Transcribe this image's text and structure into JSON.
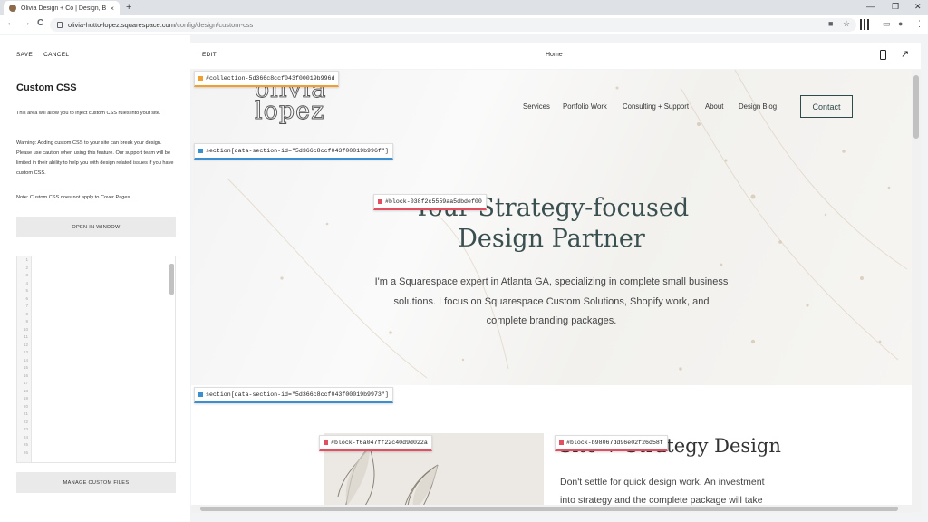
{
  "browser": {
    "tab_title": "Olivia Design + Co | Design, Bran",
    "tab_close": "×",
    "new_tab": "+",
    "window_controls": [
      "—",
      "❐",
      "✕"
    ],
    "nav_back": "←",
    "nav_forward": "→",
    "nav_reload": "C",
    "url_host": "olivia-hutto-lopez.squarespace.com",
    "url_path": "/config/design/custom-css",
    "icons": [
      "camera-icon",
      "star-icon",
      "extension-icon",
      "cast-icon",
      "profile-icon",
      "menu-icon"
    ]
  },
  "left_panel": {
    "save": "SAVE",
    "cancel": "CANCEL",
    "title": "Custom CSS",
    "intro": "This area will allow you to inject custom CSS rules into your site.",
    "warning": "Warning: Adding custom CSS to your site can break your design. Please use caution when using this feature. Our support team will be limited in their ability to help you with design related issues if you have custom CSS.",
    "note": "Note: Custom CSS does not apply to Cover Pages.",
    "open_window": "OPEN IN WINDOW",
    "manage_files": "MANAGE CUSTOM FILES",
    "line_numbers": [
      "1",
      "2",
      "3",
      "4",
      "5",
      "6",
      "7",
      "8",
      "9",
      "10",
      "11",
      "12",
      "13",
      "14",
      "15",
      "16",
      "17",
      "18",
      "19",
      "20",
      "21",
      "22",
      "23",
      "24",
      "25",
      "26"
    ]
  },
  "preview": {
    "edit": "EDIT",
    "page_name": "Home",
    "expand_glyph": "↗"
  },
  "site": {
    "logo_line1": "olivia",
    "logo_line2": "lopez",
    "nav": [
      "Services",
      "Portfolio Work",
      "Consulting + Support",
      "About",
      "Design Blog"
    ],
    "contact": "Contact",
    "headline_line1": "Your Strategy-focused",
    "headline_line2": "Design Partner",
    "subtext": "I'm a Squarespace expert in Atlanta GA, specializing in complete small business solutions. I focus on Squarespace Custom Solutions, Shopify work, and complete branding packages.",
    "section2_title": "Site + Strategy Design",
    "section2_text": "Don't settle for quick design work. An investment into strategy and the complete package will take"
  },
  "selectors": {
    "collection": "#collection-5d366c8ccf043f00019b996d",
    "section1": "section[data-section-id=\"5d366c8ccf043f00019b996f\"]",
    "block_headline": "#block-038f2c5559aa5dbdef00",
    "section2": "section[data-section-id=\"5d366c8ccf043f00019b9973\"]",
    "block_image": "#block-f6a047ff22c40d9d022a",
    "block_text": "#block-b98067dd96e02f26d58f"
  },
  "colors": {
    "accent_orange": "#f0a030",
    "accent_blue": "#3b8fd0",
    "accent_red": "#e05060",
    "brand_teal": "#2f4a4a"
  }
}
